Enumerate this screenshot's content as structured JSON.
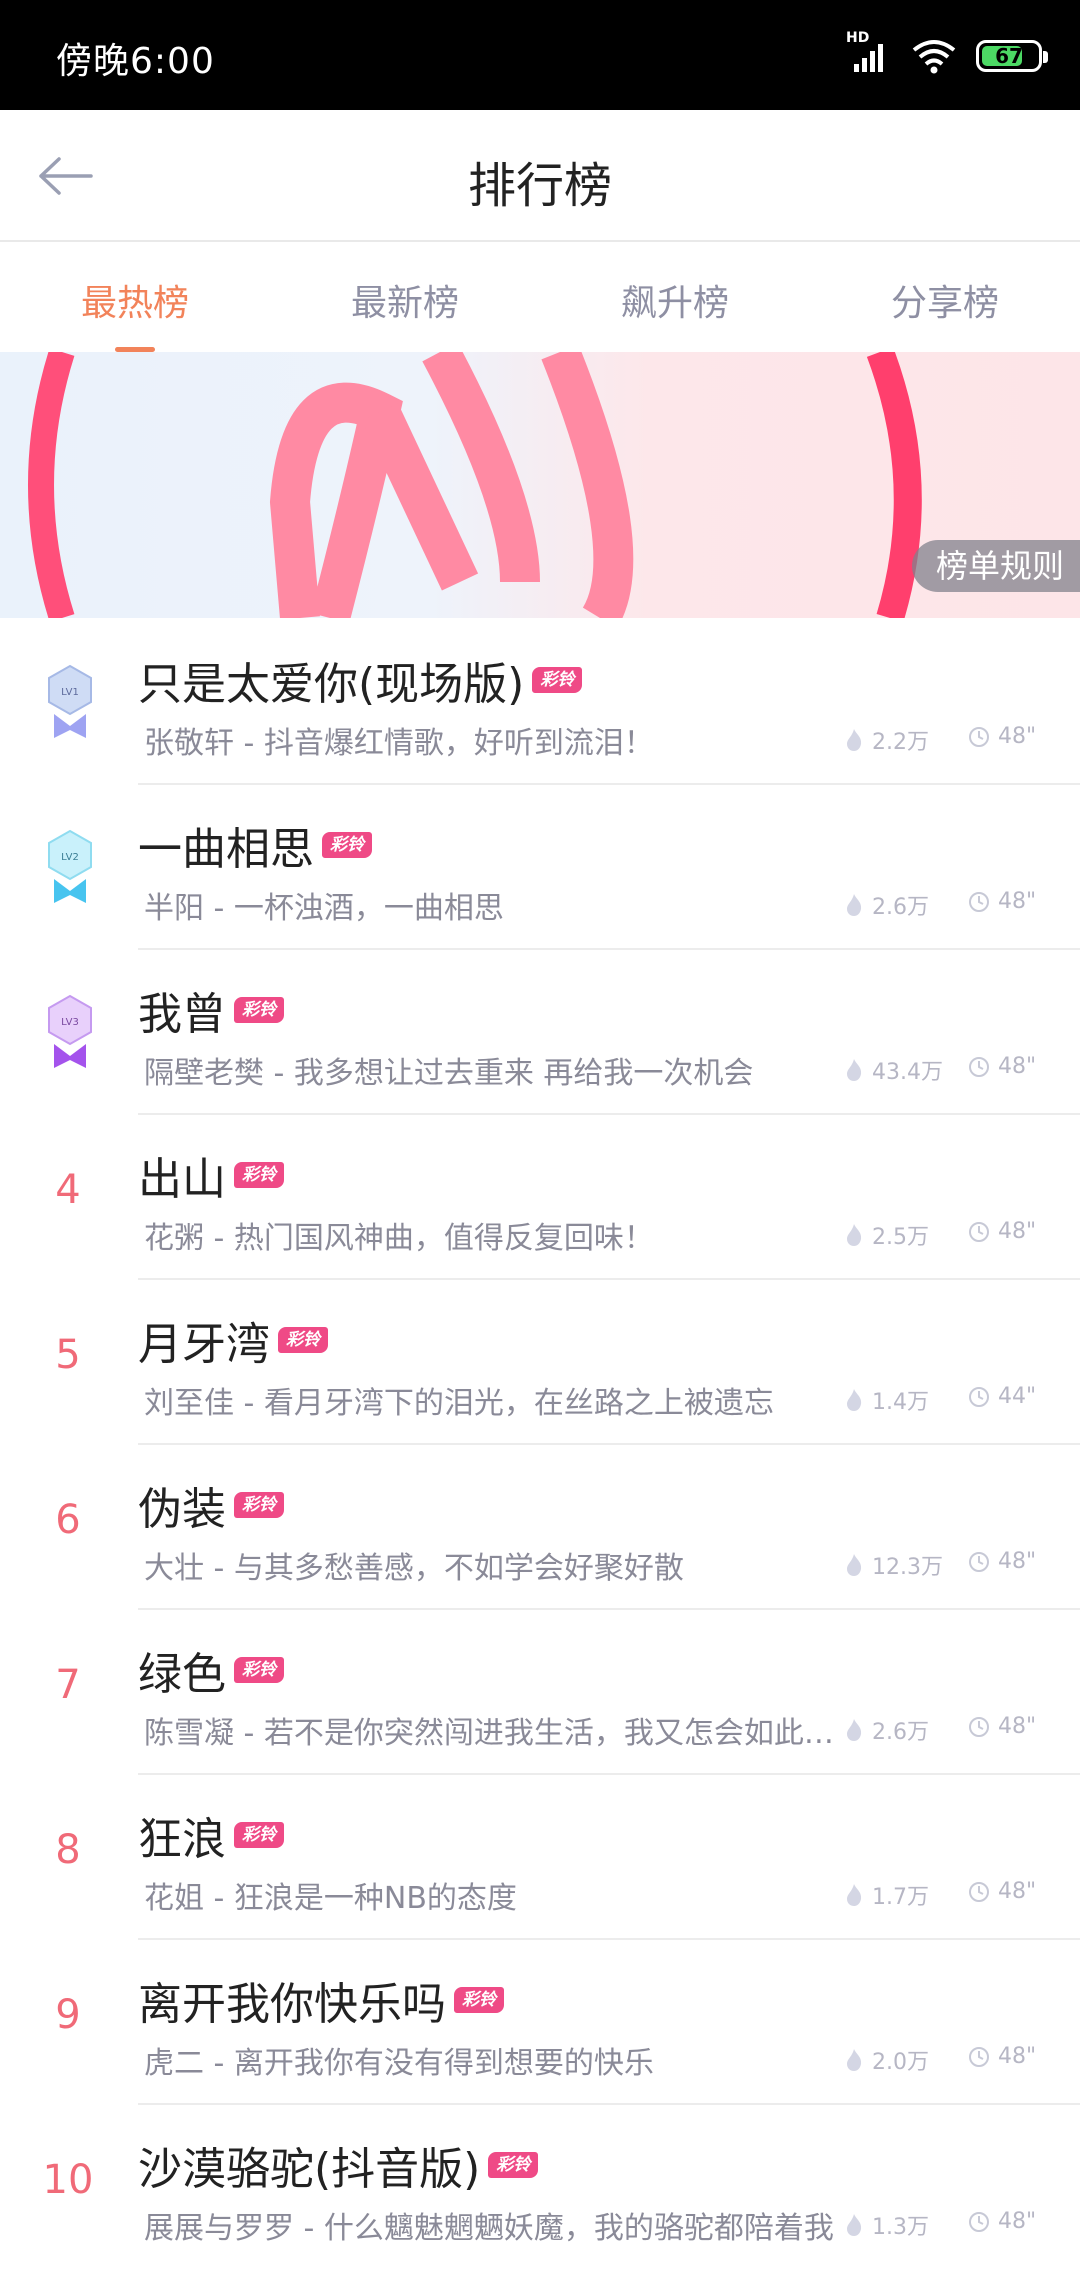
{
  "status_bar": {
    "time": "傍晚6:00",
    "network": "HD",
    "battery": "67"
  },
  "header": {
    "title": "排行榜"
  },
  "tabs": [
    {
      "label": "最热榜",
      "active": true
    },
    {
      "label": "最新榜",
      "active": false
    },
    {
      "label": "飙升榜",
      "active": false
    },
    {
      "label": "分享榜",
      "active": false
    }
  ],
  "banner": {
    "rules_label": "榜单规则"
  },
  "tag_label": "彩铃",
  "songs": [
    {
      "rank": "1",
      "badge": "LV1",
      "title": "只是太爱你(现场版)",
      "desc": "张敬轩 - 抖音爆红情歌，好听到流泪！",
      "heat": "2.2万",
      "duration": "48\""
    },
    {
      "rank": "2",
      "badge": "LV2",
      "title": "一曲相思",
      "desc": "半阳 - 一杯浊酒，一曲相思",
      "heat": "2.6万",
      "duration": "48\""
    },
    {
      "rank": "3",
      "badge": "LV3",
      "title": "我曾",
      "desc": "隔壁老樊 - 我多想让过去重来 再给我一次机会",
      "heat": "43.4万",
      "duration": "48\""
    },
    {
      "rank": "4",
      "title": "出山",
      "desc": "花粥 - 热门国风神曲，值得反复回味！",
      "heat": "2.5万",
      "duration": "48\""
    },
    {
      "rank": "5",
      "title": "月牙湾",
      "desc": "刘至佳 - 看月牙湾下的泪光，在丝路之上被遗忘",
      "heat": "1.4万",
      "duration": "44\""
    },
    {
      "rank": "6",
      "title": "伪装",
      "desc": "大壮 - 与其多愁善感，不如学会好聚好散",
      "heat": "12.3万",
      "duration": "48\""
    },
    {
      "rank": "7",
      "title": "绿色",
      "desc": "陈雪凝 - 若不是你突然闯进我生活，我又怎会如此难过",
      "heat": "2.6万",
      "duration": "48\""
    },
    {
      "rank": "8",
      "title": "狂浪",
      "desc": "花姐 - 狂浪是一种NB的态度",
      "heat": "1.7万",
      "duration": "48\""
    },
    {
      "rank": "9",
      "title": "离开我你快乐吗",
      "desc": "虎二 - 离开我你有没有得到想要的快乐",
      "heat": "2.0万",
      "duration": "48\""
    },
    {
      "rank": "10",
      "title": "沙漠骆驼(抖音版)",
      "desc": "展展与罗罗 - 什么魑魅魍魉妖魔，我的骆驼都陪着我",
      "heat": "1.3万",
      "duration": "48\""
    }
  ],
  "colors": {
    "accent": "#f2835a",
    "rank": "#f06a78",
    "tag": "#ef4a86"
  }
}
